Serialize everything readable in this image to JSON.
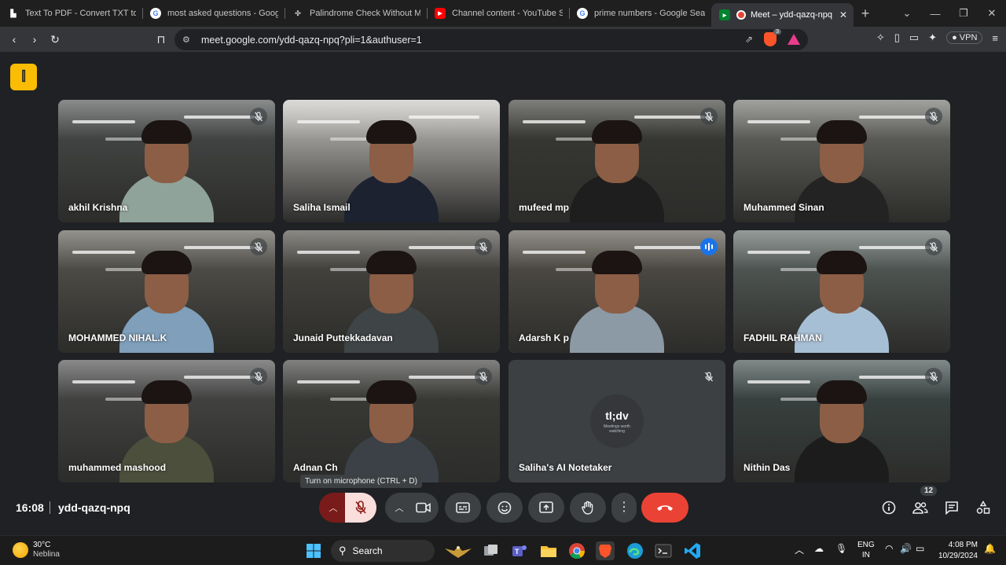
{
  "tabs": [
    {
      "title": "Text To PDF - Convert TXT to PDF",
      "favicon": "doc-icon"
    },
    {
      "title": "most asked questions - Google",
      "favicon": "google-icon"
    },
    {
      "title": "Palindrome Check Without Methods",
      "favicon": "link-icon"
    },
    {
      "title": "Channel content - YouTube Studio",
      "favicon": "youtube-icon"
    },
    {
      "title": "prime numbers - Google Search",
      "favicon": "google-icon"
    },
    {
      "title": "Meet – ydd-qazq-npq",
      "favicon": "meet-icon",
      "active": true
    }
  ],
  "address": {
    "url": "meet.google.com/ydd-qazq-npq?pli=1&authuser=1",
    "brave_shield_count": "3"
  },
  "toolbar": {
    "vpn_label": "VPN"
  },
  "participants": [
    {
      "name": "akhil Krishna",
      "muted": true,
      "shirt": "#8fa39a",
      "bg": "#4a4e4d"
    },
    {
      "name": "Saliha Ismail",
      "muted": false,
      "shirt": "#1c2230",
      "bg": "#c9c7c3"
    },
    {
      "name": "mufeed mp",
      "muted": true,
      "shirt": "#1e1e1e",
      "bg": "#3a3a36"
    },
    {
      "name": "Muhammed Sinan",
      "muted": true,
      "shirt": "#232323",
      "bg": "#6e6f69"
    },
    {
      "name": "MOHAMMED NIHAL.K",
      "muted": true,
      "shirt": "#7f9fba",
      "bg": "#5a5850"
    },
    {
      "name": "Junaid Puttekkadavan",
      "muted": true,
      "shirt": "#3f4447",
      "bg": "#4c4a44"
    },
    {
      "name": "Adarsh K p",
      "muted": false,
      "speaking": true,
      "shirt": "#8c9aa5",
      "bg": "#58544c"
    },
    {
      "name": "FADHIL RAHMAN",
      "muted": true,
      "shirt": "#a7bfd4",
      "bg": "#5d6662"
    },
    {
      "name": "muhammed mashood",
      "muted": true,
      "shirt": "#4b4f3c",
      "bg": "#4b4b4b"
    },
    {
      "name": "Adnan Ch",
      "muted": true,
      "shirt": "#3b4147",
      "bg": "#3d3d3a"
    },
    {
      "name": "Saliha's AI Notetaker",
      "muted": true,
      "ai": true
    },
    {
      "name": "Nithin Das",
      "muted": true,
      "shirt": "#1c1c1c",
      "bg": "#3c4a48"
    }
  ],
  "ai_logo": {
    "brand": "tl;dv",
    "tagline": "Meetings worth watching"
  },
  "tooltip": "Turn on microphone (CTRL + D)",
  "meeting": {
    "time": "16:08",
    "code": "ydd-qazq-npq",
    "people_count": "12"
  },
  "taskbar": {
    "weather_temp": "30°C",
    "weather_desc": "Neblina",
    "search_label": "Search",
    "lang_line1": "ENG",
    "lang_line2": "IN",
    "time": "4:08 PM",
    "date": "10/29/2024"
  },
  "colors": {
    "leave": "#ea4335",
    "mic_off_bg": "#f9dedc",
    "speaking_outline": "#8ab4f8",
    "badge": "#fbbc04"
  }
}
